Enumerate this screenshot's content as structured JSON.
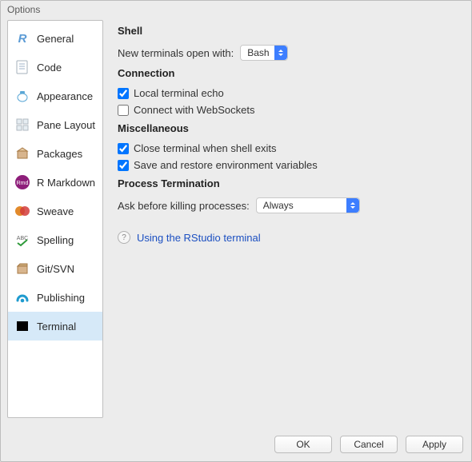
{
  "window": {
    "title": "Options"
  },
  "sidebar": {
    "items": [
      {
        "label": "General",
        "icon": "r-logo-icon",
        "icon_text": "R",
        "icon_color": "#5B9BD5",
        "selected": false
      },
      {
        "label": "Code",
        "icon": "code-page-icon",
        "icon_text": "≡",
        "icon_color": "#9fb3c8",
        "selected": false
      },
      {
        "label": "Appearance",
        "icon": "appearance-icon",
        "icon_text": "",
        "icon_color": "#5aa7d6",
        "selected": false
      },
      {
        "label": "Pane Layout",
        "icon": "panes-icon",
        "icon_text": "",
        "icon_color": "#cfd8df",
        "selected": false
      },
      {
        "label": "Packages",
        "icon": "box-icon",
        "icon_text": "",
        "icon_color": "#c19a6b",
        "selected": false
      },
      {
        "label": "R Markdown",
        "icon": "rmd-icon",
        "icon_text": "Rmd",
        "icon_color": "#8E1E7A",
        "selected": false
      },
      {
        "label": "Sweave",
        "icon": "sweave-icon",
        "icon_text": "",
        "icon_color": "#e28a2b",
        "selected": false
      },
      {
        "label": "Spelling",
        "icon": "spelling-icon",
        "icon_text": "ABC",
        "icon_color": "#6b6b6b",
        "selected": false
      },
      {
        "label": "Git/SVN",
        "icon": "git-icon",
        "icon_text": "",
        "icon_color": "#b98c52",
        "selected": false
      },
      {
        "label": "Publishing",
        "icon": "publish-icon",
        "icon_text": "",
        "icon_color": "#1f9bcf",
        "selected": false
      },
      {
        "label": "Terminal",
        "icon": "terminal-icon",
        "icon_text": "",
        "icon_color": "#000000",
        "selected": true
      }
    ]
  },
  "sections": {
    "shell": {
      "title": "Shell",
      "new_terminals_label": "New terminals open with:",
      "new_terminals_value": "Bash"
    },
    "connection": {
      "title": "Connection",
      "local_echo_label": "Local terminal echo",
      "local_echo_checked": true,
      "websockets_label": "Connect with WebSockets",
      "websockets_checked": false
    },
    "misc": {
      "title": "Miscellaneous",
      "close_on_exit_label": "Close terminal when shell exits",
      "close_on_exit_checked": true,
      "save_env_label": "Save and restore environment variables",
      "save_env_checked": true
    },
    "termination": {
      "title": "Process Termination",
      "ask_label": "Ask before killing processes:",
      "ask_value": "Always"
    }
  },
  "help": {
    "link_text": "Using the RStudio terminal"
  },
  "footer": {
    "ok": "OK",
    "cancel": "Cancel",
    "apply": "Apply"
  }
}
